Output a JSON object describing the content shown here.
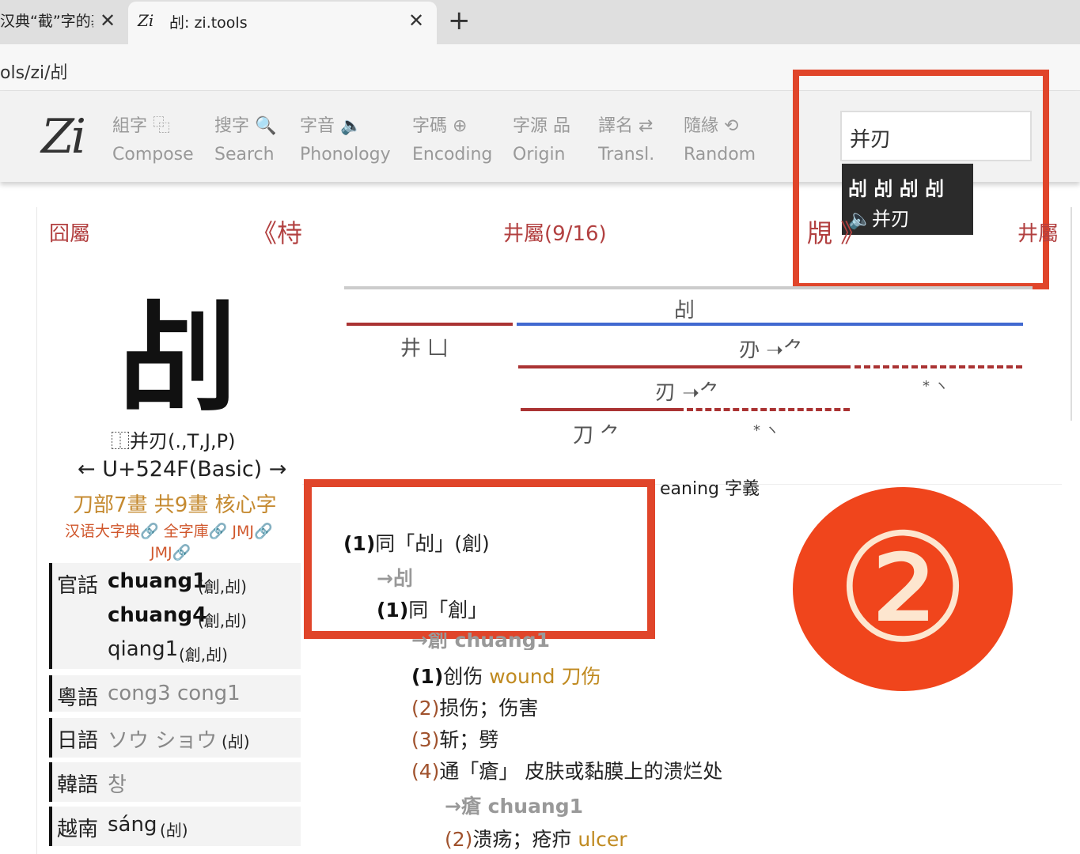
{
  "browser": {
    "tabs": [
      {
        "title": "汉典“截”字的基",
        "close": "✕"
      },
      {
        "title": "㓠: zi.tools",
        "icon": "Zi",
        "close": "✕"
      }
    ],
    "new_tab": "+",
    "url": "ols/zi/㓠"
  },
  "site": {
    "logo": "Zi",
    "nav": [
      {
        "top": "組字 ⿻",
        "bottom": "Compose"
      },
      {
        "top": "搜字 🔍",
        "bottom": "Search"
      },
      {
        "top": "字音 🔈",
        "bottom": "Phonology"
      },
      {
        "top": "字碼 ⊕",
        "bottom": "Encoding"
      },
      {
        "top": "字源 品",
        "bottom": "Origin"
      },
      {
        "top": "譯名 ⇄",
        "bottom": "Transl."
      },
      {
        "top": "隨緣 ⟲",
        "bottom": "Random"
      }
    ],
    "search": {
      "value": "并刃",
      "suggest_chars": "㓠 㓠 㓠 㓠",
      "suggest_phon": "🔈并刃"
    }
  },
  "radical_nav": {
    "left_radical": "囧屬",
    "prev": "《㭙",
    "current": "井屬(9/16)",
    "next": "覑 》",
    "right": "井屬"
  },
  "character": {
    "glyph": "㓠",
    "ids": "⿰并刃(.,T,J,P)",
    "codepoint": "← U+524F(Basic) →",
    "strokes": "刀部7畫 共9畫 核心字",
    "links": "汉语大字典🔗 全字庫🔗 JMJ🔗",
    "links2": "JMJ🔗"
  },
  "readings": {
    "mandarin_label": "官話",
    "mandarin": [
      "chuang1",
      "chuang4",
      "qiang1"
    ],
    "mandarin_notes": [
      "(創,㓠)",
      "(創,㓠)",
      "(創,㓠)"
    ],
    "cantonese_label": "粵語",
    "cantonese": "cong3 cong1",
    "japanese_label": "日語",
    "japanese": "ソウ ショウ",
    "japanese_note": "(㓠)",
    "korean_label": "韓語",
    "korean": "창",
    "vietnamese_label": "越南",
    "vietnamese": "sáng",
    "vietnamese_note": "(㓠)"
  },
  "structure": {
    "root": "㓠",
    "left": "井 ⼐",
    "right": "刅 ➝⺈",
    "mid": "刃 ➝⺈",
    "bottom": "刀 ⺈",
    "star1": "* ヽ",
    "star2": "* ヽ"
  },
  "meaning": {
    "header": "eaning 字義",
    "items": [
      {
        "num": "(1)",
        "text": "同「㓠」(創)"
      },
      {
        "arrow": "→㓠"
      },
      {
        "num": "(1)",
        "text": "同「創」"
      },
      {
        "arrow": "→創 chuang1"
      },
      {
        "num": "(1)",
        "text": "创伤 ",
        "en": "wound 刀伤"
      },
      {
        "num": "(2)",
        "text": "损伤；伤害"
      },
      {
        "num": "(3)",
        "text": "斩；劈"
      },
      {
        "num": "(4)",
        "text": "通「瘡」 皮肤或黏膜上的溃烂处"
      },
      {
        "arrow": "→瘡 chuang1"
      },
      {
        "num": "(2)",
        "text": "溃疡；疮疖 ",
        "en": "ulcer"
      }
    ]
  },
  "annotation_badge": "②"
}
